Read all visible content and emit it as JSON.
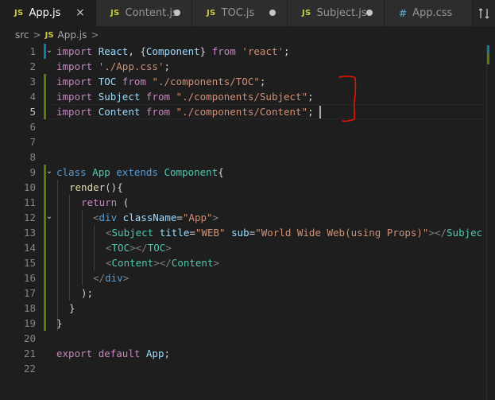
{
  "tabs": [
    {
      "badge": "JS",
      "label": "App.js",
      "state": "close",
      "active": true
    },
    {
      "badge": "JS",
      "label": "Content.js",
      "state": "dirty",
      "active": false
    },
    {
      "badge": "JS",
      "label": "TOC.js",
      "state": "dirty",
      "active": false
    },
    {
      "badge": "JS",
      "label": "Subject.js",
      "state": "dirty",
      "active": false
    },
    {
      "badge": "#",
      "label": "App.css",
      "state": "none",
      "active": false
    }
  ],
  "tab_close_glyph": "×",
  "breadcrumb": {
    "folder": "src",
    "separator": ">",
    "file_badge": "JS",
    "file": "App.js",
    "trail": ">"
  },
  "line_numbers": [
    "1",
    "2",
    "3",
    "4",
    "5",
    "6",
    "7",
    "8",
    "9",
    "10",
    "11",
    "12",
    "13",
    "14",
    "15",
    "16",
    "17",
    "18",
    "19",
    "20",
    "21",
    "22"
  ],
  "code": {
    "l1": {
      "import": "import",
      "react": "React",
      "comma": ", {",
      "component": "Component",
      "close": "}",
      "from": "from",
      "module": "'react'",
      "semi": ";"
    },
    "l2": {
      "import": "import",
      "module": "'./App.css'",
      "semi": ";"
    },
    "l3": {
      "import": "import",
      "name": "TOC",
      "from": "from",
      "module": "\"./components/TOC\"",
      "semi": ";"
    },
    "l4": {
      "import": "import",
      "name": "Subject",
      "from": "from",
      "module": "\"./components/Subject\"",
      "semi": ";"
    },
    "l5": {
      "import": "import",
      "name": "Content",
      "from": "from",
      "module": "\"./components/Content\"",
      "semi": ";"
    },
    "l9": {
      "class": "class",
      "name": "App",
      "extends": "extends",
      "base": "Component",
      "brace": "{"
    },
    "l10": {
      "fn": "render",
      "rest": "(){"
    },
    "l11": {
      "return": "return",
      "paren": "("
    },
    "l12": {
      "open": "<",
      "tag": "div",
      "attr": "className",
      "eq": "=",
      "val": "\"App\"",
      "close": ">"
    },
    "l13": {
      "open": "<",
      "tag": "Subject",
      "attr1": "title",
      "eq1": "=",
      "val1": "\"WEB\"",
      "attr2": "sub",
      "eq2": "=",
      "val2": "\"World Wide Web(using Props)\"",
      "close": "></",
      "tag2": "Subjec"
    },
    "l14": {
      "open": "<",
      "tag": "TOC",
      "mid": "></",
      "tag2": "TOC",
      "close": ">"
    },
    "l15": {
      "open": "<",
      "tag": "Content",
      "mid": "></",
      "tag2": "Content",
      "close": ">"
    },
    "l16": {
      "open": "</",
      "tag": "div",
      "close": ">"
    },
    "l17": {
      "text": ");"
    },
    "l18": {
      "text": "}"
    },
    "l19": {
      "text": "}"
    },
    "l21": {
      "export": "export",
      "default": "default",
      "name": "App",
      "semi": ";"
    }
  },
  "colors": {
    "annotation": "#e51400",
    "git_added": "#587c0c",
    "git_modified": "#0c7d9d"
  },
  "icons": [
    "close-icon",
    "modified-dot-icon",
    "chevron-right-icon",
    "fold-chevron-icon",
    "split-editor-icon",
    "css-hash-icon"
  ]
}
